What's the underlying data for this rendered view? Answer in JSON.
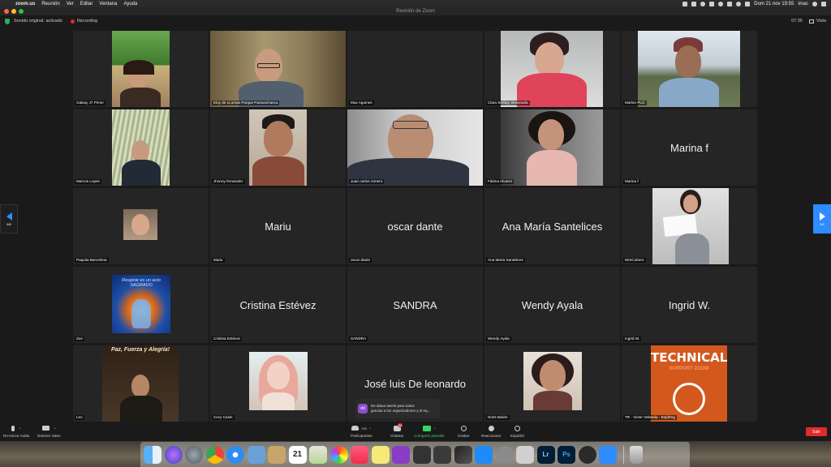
{
  "menubar": {
    "app_name": "zoom.us",
    "menus": [
      "Reunión",
      "Ver",
      "Editar",
      "Ventana",
      "Ayuda"
    ],
    "datetime": "Dom 21 nov  19:55",
    "user": "imac"
  },
  "window": {
    "title": "Reunión de Zoom"
  },
  "infobar": {
    "audio_status": "Sonido original: activado",
    "recording": "Recording",
    "time": "07:35",
    "view_label": "Vista"
  },
  "participants": [
    {
      "name": "Galaxy J7 Prime",
      "video": true
    },
    {
      "name": "Eloy de LLomas Parque Paravachasca",
      "video": true
    },
    {
      "name": "Max Agames",
      "video": false,
      "center_text": ""
    },
    {
      "name": "Clara Serfaty Venezuela",
      "video": true
    },
    {
      "name": "Marlon PLO",
      "video": true
    },
    {
      "name": "Marcos Lopes",
      "video": true
    },
    {
      "name": "Jhonny fernandez",
      "video": true
    },
    {
      "name": "Juan carlos romero",
      "video": true
    },
    {
      "name": "Fátima Alvarez",
      "video": true
    },
    {
      "name": "Marina f",
      "video": false,
      "center_text": "Marina f"
    },
    {
      "name": "Paquita Barcelona",
      "video": true
    },
    {
      "name": "Mariu",
      "video": false,
      "center_text": "Mariu"
    },
    {
      "name": "oscar dante",
      "video": false,
      "center_text": "oscar dante"
    },
    {
      "name": "Ana María Santelices",
      "video": false,
      "center_text": "Ana María Santelices"
    },
    {
      "name": "NireCobero",
      "video": true
    },
    {
      "name": "Zoe",
      "video": true,
      "poster_text": "Respirar es un acto SAGRADO"
    },
    {
      "name": "Cristina Estévez",
      "video": false,
      "center_text": "Cristina Estévez"
    },
    {
      "name": "SANDRA",
      "video": false,
      "center_text": "SANDRA"
    },
    {
      "name": "Wendy Ayala",
      "video": false,
      "center_text": "Wendy Ayala"
    },
    {
      "name": "Ingrid W.",
      "video": false,
      "center_text": "Ingrid W."
    },
    {
      "name": "Leo",
      "video": true,
      "poster_text": "Paz, Fuerza y Alegría!"
    },
    {
      "name": "Cecy Casin",
      "video": true
    },
    {
      "name": "",
      "video": false,
      "center_text": "José luis De leonardo"
    },
    {
      "name": "Doris Balvin",
      "video": true
    },
    {
      "name": "TR - Victor Velesela - Esp/Eng",
      "video": true,
      "poster_text": "TECHNICAL",
      "poster_sub": "SUPPORT ZOOM"
    }
  ],
  "pager": {
    "left": "6/6",
    "right": "6/6"
  },
  "chat_popup": {
    "initials": "dd",
    "line1": "De diana aeiele para todos",
    "line2": "gracias a los organizadores y el eq..."
  },
  "toolbar": {
    "audio": "Re-iniciar Audio",
    "video": "Detener video",
    "participants": "Participantes",
    "participants_count": "200",
    "chat": "Chatear",
    "chat_badge": "34",
    "share": "Compartir pantalla",
    "record": "Grabar",
    "reactions": "Reacciones",
    "language": "Español",
    "leave": "Salir"
  },
  "dock": {
    "apps": [
      "finder",
      "siri",
      "launchpad",
      "chrome",
      "safari",
      "preview",
      "notes",
      "calendar",
      "photos-view",
      "photos",
      "music",
      "stickies",
      "podcasts",
      "quicktime",
      "imovie",
      "final-cut",
      "app-store",
      "system-preferences",
      "files",
      "lightroom",
      "photoshop",
      "quicktime-2",
      "zoom",
      "trash"
    ],
    "calendar_day": "21",
    "lr": "Lr",
    "ps": "Ps"
  },
  "colors": {
    "accent": "#2d8cff",
    "record": "#e02b2b",
    "share": "#3ad06a"
  }
}
